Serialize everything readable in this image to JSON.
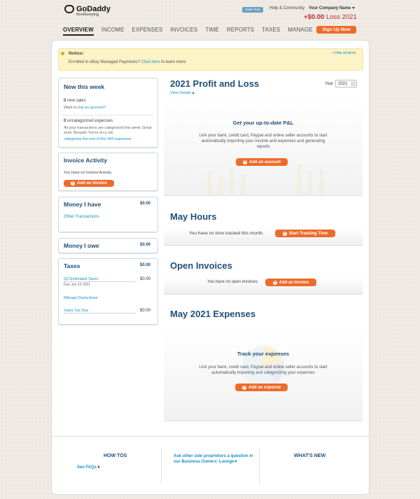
{
  "header": {
    "logo_text": "GoDaddy",
    "logo_sub": "Bookkeeping",
    "sales_tab": "Sales Tour",
    "help_link": "Help & Community",
    "company_name": "Your Company Name",
    "pl_amount": "+$0.00",
    "pl_label": "Loss 2021",
    "signup": "Sign Up Now"
  },
  "nav": [
    "OVERVIEW",
    "INCOME",
    "EXPENSES",
    "INVOICES",
    "TIME",
    "REPORTS",
    "TAXES",
    "MANAGE"
  ],
  "notice": {
    "title": "Notice:",
    "text_before": "Enrolled in eBay Managed Payments?",
    "link": "Click here",
    "text_after": "to learn more.",
    "hide": "» Hide all alerts"
  },
  "new_this_week": {
    "title": "New this week",
    "sales_count": "0",
    "sales_label": "new sales",
    "want_to": "Want to",
    "link_account": "link an account?",
    "uncat_count": "0",
    "uncat_label": "uncategorized expenses",
    "uncat_text": "All your transactions are categorized this week. Great work. Booyah! You're on a roll",
    "uncat_link": "categorize the rest of the 494 expenses"
  },
  "invoice_activity": {
    "title": "Invoice Activity",
    "empty": "You have no Invoice Activity.",
    "button": "Add an Invoice"
  },
  "money_i_have": {
    "title": "Money I have",
    "amount": "$0.00",
    "item": "Other Transactions"
  },
  "money_i_owe": {
    "title": "Money I owe",
    "amount": "$0.00"
  },
  "taxes": {
    "title": "Taxes",
    "amount": "$0.00",
    "q2_label": "Q2 Estimated Taxes",
    "q2_due": "Due Jun 15 2021",
    "q2_amount": "$0.00",
    "mileage": "Mileage Deductions",
    "sales_tax": "Sales Tax Due",
    "sales_tax_amount": "$0.00"
  },
  "profit_loss": {
    "title": "2021 Profit and Loss",
    "view_details": "View Details",
    "year_label": "Year",
    "year_value": "2021",
    "get_title": "Get your up-to-date P&L",
    "get_text": "Link your bank, credit card, Paypal and online seller accounts to start automatically importing your income and expenses and generating reports",
    "button": "Add an account"
  },
  "hours": {
    "title": "May Hours",
    "empty": "You have no time tracked this month.",
    "button": "Start Tracking Time"
  },
  "open_invoices": {
    "title": "Open Invoices",
    "empty": "You have no open invoices.",
    "button": "Add an Invoice"
  },
  "expenses": {
    "title": "May 2021 Expenses",
    "track_title": "Track your expenses",
    "track_text": "Link your bank, credit card, Paypal and online seller accounts to start automatically importing and categorizing your expenses",
    "button": "Add an expense"
  },
  "footer": {
    "howtos": "HOW TOS",
    "faqs": "See FAQs",
    "ask_text": "Ask other sole proprietors a question in our Business Owners' Lounge",
    "whats_new": "WHAT'S NEW"
  },
  "colors": {
    "brand_blue": "#1f4e79",
    "link_blue": "#1a8fc9",
    "orange": "#ed6b2b",
    "loss_red": "#c2272d",
    "notice_yellow": "#fcf3c6"
  }
}
